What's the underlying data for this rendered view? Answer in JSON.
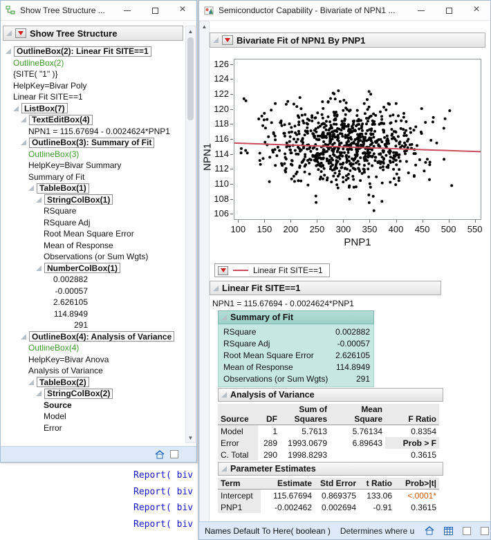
{
  "left_window": {
    "title": "Show Tree Structure ...",
    "header": "Show Tree Structure",
    "tree": [
      {
        "indent": 0,
        "type": "boxed",
        "disclosure": true,
        "label": "OutlineBox(2): Linear Fit SITE==1"
      },
      {
        "indent": 1,
        "type": "green",
        "label": "OutlineBox(2)"
      },
      {
        "indent": 1,
        "type": "plain",
        "label": "{SITE( \"1\" )}"
      },
      {
        "indent": 1,
        "type": "plain",
        "label": "HelpKey=Bivar Poly"
      },
      {
        "indent": 1,
        "type": "plain",
        "label": "Linear Fit SITE==1"
      },
      {
        "indent": 1,
        "type": "boxed",
        "disclosure": true,
        "label": "ListBox(7)"
      },
      {
        "indent": 2,
        "type": "boxed",
        "disclosure": true,
        "label": "TextEditBox(4)"
      },
      {
        "indent": 3,
        "type": "plain",
        "label": "NPN1 = 115.67694 - 0.0024624*PNP1"
      },
      {
        "indent": 2,
        "type": "boxed",
        "disclosure": true,
        "label": "OutlineBox(3): Summary of Fit"
      },
      {
        "indent": 3,
        "type": "green",
        "label": "OutlineBox(3)"
      },
      {
        "indent": 3,
        "type": "plain",
        "label": "HelpKey=Bivar Summary"
      },
      {
        "indent": 3,
        "type": "plain",
        "label": "Summary of Fit"
      },
      {
        "indent": 3,
        "type": "boxed",
        "disclosure": true,
        "label": "TableBox(1)"
      },
      {
        "indent": 4,
        "type": "boxed",
        "disclosure": true,
        "label": "StringColBox(1)"
      },
      {
        "indent": 5,
        "type": "plain",
        "label": "RSquare"
      },
      {
        "indent": 5,
        "type": "plain",
        "label": "RSquare Adj"
      },
      {
        "indent": 5,
        "type": "plain",
        "label": "Root Mean Square Error"
      },
      {
        "indent": 5,
        "type": "plain",
        "label": "Mean of Response"
      },
      {
        "indent": 5,
        "type": "plain",
        "label": "Observations (or Sum Wgts)"
      },
      {
        "indent": 4,
        "type": "boxed",
        "disclosure": true,
        "label": "NumberColBox(1)"
      },
      {
        "indent": 5,
        "type": "num",
        "label": "0.002882"
      },
      {
        "indent": 5,
        "type": "num",
        "label": "-0.00057"
      },
      {
        "indent": 5,
        "type": "num",
        "label": "2.626105"
      },
      {
        "indent": 5,
        "type": "num",
        "label": "114.8949"
      },
      {
        "indent": 5,
        "type": "num",
        "label": "291"
      },
      {
        "indent": 2,
        "type": "boxed",
        "disclosure": true,
        "label": "OutlineBox(4): Analysis of Variance"
      },
      {
        "indent": 3,
        "type": "green",
        "label": "OutlineBox(4)"
      },
      {
        "indent": 3,
        "type": "plain",
        "label": "HelpKey=Bivar Anova"
      },
      {
        "indent": 3,
        "type": "plain",
        "label": "Analysis of Variance"
      },
      {
        "indent": 3,
        "type": "boxed",
        "disclosure": true,
        "label": "TableBox(2)"
      },
      {
        "indent": 4,
        "type": "boxed",
        "disclosure": true,
        "label": "StringColBox(2)"
      },
      {
        "indent": 5,
        "type": "bold",
        "label": "Source"
      },
      {
        "indent": 5,
        "type": "plain",
        "label": "Model"
      },
      {
        "indent": 5,
        "type": "plain",
        "label": "Error"
      }
    ]
  },
  "script_editor": {
    "lines": [
      "Report( biv",
      "Report( biv",
      "Report( biv",
      "Report( biv"
    ]
  },
  "right_window": {
    "title": "Semiconductor Capability - Bivariate of NPN1 ...",
    "report_title": "Bivariate Fit of NPN1 By PNP1",
    "legend_label": "Linear Fit SITE==1",
    "fit_header": "Linear Fit SITE==1",
    "equation": "NPN1 = 115.67694 - 0.0024624*PNP1",
    "summary_of_fit": {
      "header": "Summary of Fit",
      "rows": [
        [
          "RSquare",
          "0.002882"
        ],
        [
          "RSquare Adj",
          "-0.00057"
        ],
        [
          "Root Mean Square Error",
          "2.626105"
        ],
        [
          "Mean of Response",
          "114.8949"
        ],
        [
          "Observations (or Sum Wgts)",
          "291"
        ]
      ]
    },
    "anova": {
      "header": "Analysis of Variance",
      "columns": [
        "Source",
        "DF",
        "Sum of\nSquares",
        "Mean Square",
        "F Ratio"
      ],
      "rows": [
        [
          "Model",
          "1",
          "5.7613",
          "5.76134",
          "0.8354"
        ],
        [
          "Error",
          "289",
          "1993.0679",
          "6.89643",
          "Prob > F"
        ],
        [
          "C. Total",
          "290",
          "1998.8293",
          "",
          "0.3615"
        ]
      ],
      "header_cells": [
        [
          1,
          4
        ]
      ]
    },
    "parameter_estimates": {
      "header": "Parameter Estimates",
      "columns": [
        "Term",
        "Estimate",
        "Std Error",
        "t Ratio",
        "Prob>|t|"
      ],
      "rows": [
        [
          "Intercept",
          "115.67694",
          "0.869375",
          "133.06",
          "<.0001*"
        ],
        [
          "PNP1",
          "-0.002462",
          "0.002694",
          "-0.91",
          "0.3615"
        ]
      ],
      "accent_cells": [
        [
          0,
          4
        ]
      ]
    },
    "status_left": "Names Default To Here( boolean )",
    "status_right": "Determines where unres"
  },
  "chart_data": {
    "type": "scatter",
    "title": "Bivariate Fit of NPN1 By PNP1",
    "xlabel": "PNP1",
    "ylabel": "NPN1",
    "xlim": [
      93,
      561
    ],
    "ylim": [
      105.3,
      126.6
    ],
    "x_ticks": [
      100,
      150,
      200,
      250,
      300,
      350,
      400,
      450,
      500,
      550
    ],
    "y_ticks": [
      126,
      124,
      122,
      120,
      118,
      116,
      114,
      112,
      110,
      108,
      106
    ],
    "grid": false,
    "observations": 291,
    "point_color": "#000000",
    "cloud": {
      "count": 840,
      "x_mean": 306,
      "x_sd": 72,
      "y_mean": 115.2,
      "y_sd": 2.7,
      "seed": 20130607
    },
    "fit_line": {
      "equation": "NPN1 = 115.67694 - 0.0024624*PNP1",
      "intercept": 115.67694,
      "slope": -0.0024624,
      "color": "#c84b59"
    }
  },
  "colors": {
    "accent_red": "#d11c1c",
    "fit_line": "#c84b59",
    "teal_header": "#a9d8d1",
    "teal_body": "#c7e7e2",
    "tree_green": "#3c9b28",
    "script_blue": "#1414cc",
    "accent_orange": "#cc5500",
    "table_header_bg": "#eaeaea",
    "status_bar_bg": "#dde9f7"
  }
}
